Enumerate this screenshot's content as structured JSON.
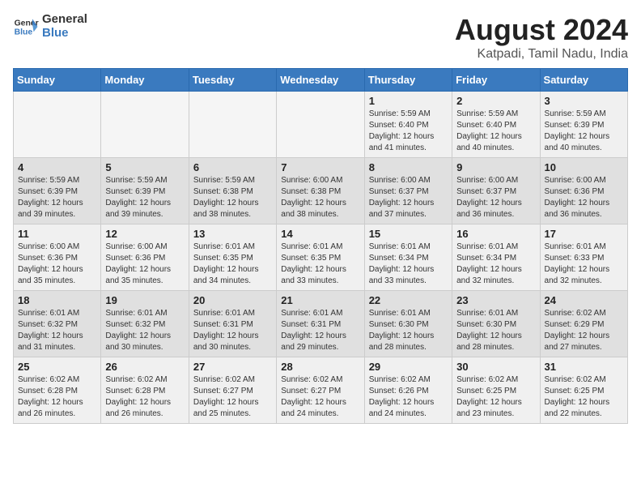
{
  "header": {
    "logo_line1": "General",
    "logo_line2": "Blue",
    "main_title": "August 2024",
    "subtitle": "Katpadi, Tamil Nadu, India"
  },
  "calendar": {
    "days_of_week": [
      "Sunday",
      "Monday",
      "Tuesday",
      "Wednesday",
      "Thursday",
      "Friday",
      "Saturday"
    ],
    "weeks": [
      [
        {
          "day": "",
          "info": ""
        },
        {
          "day": "",
          "info": ""
        },
        {
          "day": "",
          "info": ""
        },
        {
          "day": "",
          "info": ""
        },
        {
          "day": "1",
          "info": "Sunrise: 5:59 AM\nSunset: 6:40 PM\nDaylight: 12 hours\nand 41 minutes."
        },
        {
          "day": "2",
          "info": "Sunrise: 5:59 AM\nSunset: 6:40 PM\nDaylight: 12 hours\nand 40 minutes."
        },
        {
          "day": "3",
          "info": "Sunrise: 5:59 AM\nSunset: 6:39 PM\nDaylight: 12 hours\nand 40 minutes."
        }
      ],
      [
        {
          "day": "4",
          "info": "Sunrise: 5:59 AM\nSunset: 6:39 PM\nDaylight: 12 hours\nand 39 minutes."
        },
        {
          "day": "5",
          "info": "Sunrise: 5:59 AM\nSunset: 6:39 PM\nDaylight: 12 hours\nand 39 minutes."
        },
        {
          "day": "6",
          "info": "Sunrise: 5:59 AM\nSunset: 6:38 PM\nDaylight: 12 hours\nand 38 minutes."
        },
        {
          "day": "7",
          "info": "Sunrise: 6:00 AM\nSunset: 6:38 PM\nDaylight: 12 hours\nand 38 minutes."
        },
        {
          "day": "8",
          "info": "Sunrise: 6:00 AM\nSunset: 6:37 PM\nDaylight: 12 hours\nand 37 minutes."
        },
        {
          "day": "9",
          "info": "Sunrise: 6:00 AM\nSunset: 6:37 PM\nDaylight: 12 hours\nand 36 minutes."
        },
        {
          "day": "10",
          "info": "Sunrise: 6:00 AM\nSunset: 6:36 PM\nDaylight: 12 hours\nand 36 minutes."
        }
      ],
      [
        {
          "day": "11",
          "info": "Sunrise: 6:00 AM\nSunset: 6:36 PM\nDaylight: 12 hours\nand 35 minutes."
        },
        {
          "day": "12",
          "info": "Sunrise: 6:00 AM\nSunset: 6:36 PM\nDaylight: 12 hours\nand 35 minutes."
        },
        {
          "day": "13",
          "info": "Sunrise: 6:01 AM\nSunset: 6:35 PM\nDaylight: 12 hours\nand 34 minutes."
        },
        {
          "day": "14",
          "info": "Sunrise: 6:01 AM\nSunset: 6:35 PM\nDaylight: 12 hours\nand 33 minutes."
        },
        {
          "day": "15",
          "info": "Sunrise: 6:01 AM\nSunset: 6:34 PM\nDaylight: 12 hours\nand 33 minutes."
        },
        {
          "day": "16",
          "info": "Sunrise: 6:01 AM\nSunset: 6:34 PM\nDaylight: 12 hours\nand 32 minutes."
        },
        {
          "day": "17",
          "info": "Sunrise: 6:01 AM\nSunset: 6:33 PM\nDaylight: 12 hours\nand 32 minutes."
        }
      ],
      [
        {
          "day": "18",
          "info": "Sunrise: 6:01 AM\nSunset: 6:32 PM\nDaylight: 12 hours\nand 31 minutes."
        },
        {
          "day": "19",
          "info": "Sunrise: 6:01 AM\nSunset: 6:32 PM\nDaylight: 12 hours\nand 30 minutes."
        },
        {
          "day": "20",
          "info": "Sunrise: 6:01 AM\nSunset: 6:31 PM\nDaylight: 12 hours\nand 30 minutes."
        },
        {
          "day": "21",
          "info": "Sunrise: 6:01 AM\nSunset: 6:31 PM\nDaylight: 12 hours\nand 29 minutes."
        },
        {
          "day": "22",
          "info": "Sunrise: 6:01 AM\nSunset: 6:30 PM\nDaylight: 12 hours\nand 28 minutes."
        },
        {
          "day": "23",
          "info": "Sunrise: 6:01 AM\nSunset: 6:30 PM\nDaylight: 12 hours\nand 28 minutes."
        },
        {
          "day": "24",
          "info": "Sunrise: 6:02 AM\nSunset: 6:29 PM\nDaylight: 12 hours\nand 27 minutes."
        }
      ],
      [
        {
          "day": "25",
          "info": "Sunrise: 6:02 AM\nSunset: 6:28 PM\nDaylight: 12 hours\nand 26 minutes."
        },
        {
          "day": "26",
          "info": "Sunrise: 6:02 AM\nSunset: 6:28 PM\nDaylight: 12 hours\nand 26 minutes."
        },
        {
          "day": "27",
          "info": "Sunrise: 6:02 AM\nSunset: 6:27 PM\nDaylight: 12 hours\nand 25 minutes."
        },
        {
          "day": "28",
          "info": "Sunrise: 6:02 AM\nSunset: 6:27 PM\nDaylight: 12 hours\nand 24 minutes."
        },
        {
          "day": "29",
          "info": "Sunrise: 6:02 AM\nSunset: 6:26 PM\nDaylight: 12 hours\nand 24 minutes."
        },
        {
          "day": "30",
          "info": "Sunrise: 6:02 AM\nSunset: 6:25 PM\nDaylight: 12 hours\nand 23 minutes."
        },
        {
          "day": "31",
          "info": "Sunrise: 6:02 AM\nSunset: 6:25 PM\nDaylight: 12 hours\nand 22 minutes."
        }
      ]
    ]
  }
}
